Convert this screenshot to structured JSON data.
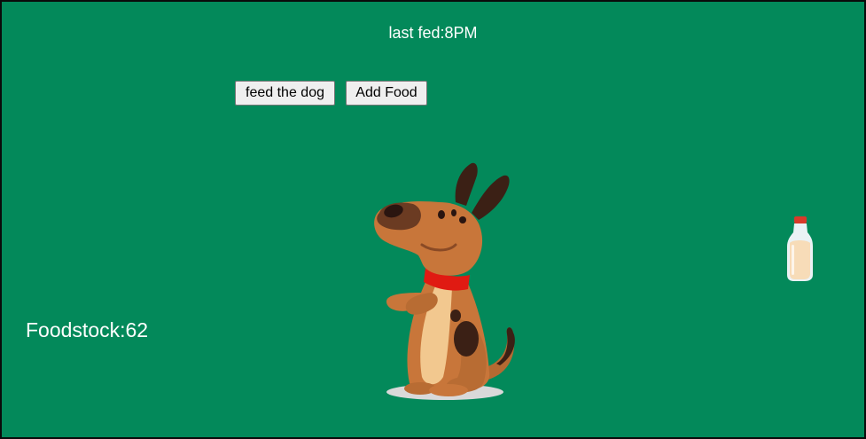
{
  "status": {
    "last_fed_label": "last fed:8PM"
  },
  "controls": {
    "feed_label": "feed the dog",
    "add_food_label": "Add Food"
  },
  "stock": {
    "food_stock_label": "Foodstock:62"
  },
  "colors": {
    "background": "#03895a",
    "text": "#ffffff",
    "dog_body": "#c8763a",
    "dog_collar": "#e01a12"
  },
  "sprites": {
    "dog": "dog-sprite",
    "food": "milk-bottle-sprite"
  }
}
